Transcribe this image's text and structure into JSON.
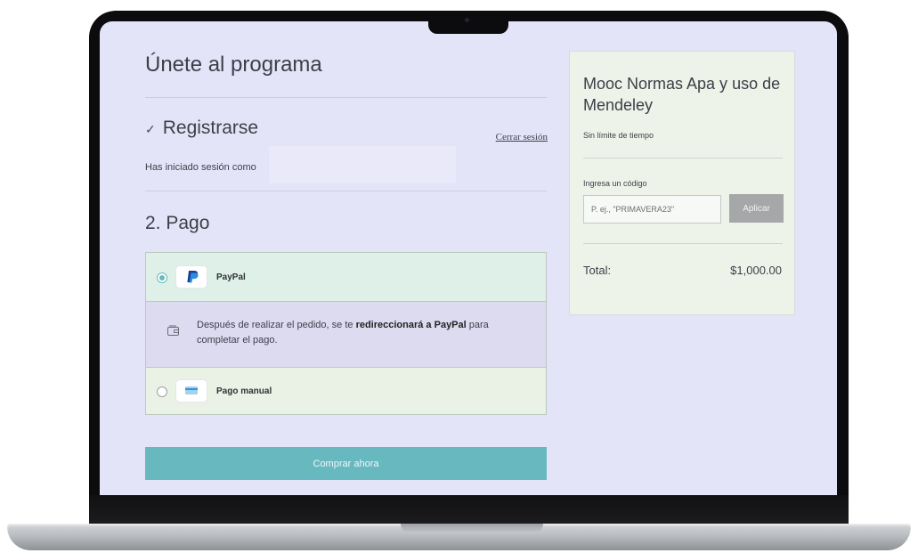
{
  "page": {
    "title": "Únete al programa",
    "step1": {
      "check": "✓",
      "title": "Registrarse",
      "logout": "Cerrar sesión",
      "session_text": "Has iniciado sesión como"
    },
    "step2": {
      "title": "2. Pago"
    },
    "payment": {
      "selected": "PayPal",
      "options": [
        {
          "label": "PayPal",
          "icon": "paypal-logo-icon",
          "selected": true
        },
        {
          "label": "Pago manual",
          "icon": "card-icon",
          "selected": false
        }
      ],
      "info": {
        "part1": "Después de realizar el pedido, se te ",
        "bold": "redireccionará a PayPal",
        "part2": " para completar el pago."
      }
    },
    "buy_button": "Comprar ahora"
  },
  "summary": {
    "course": "Mooc Normas Apa y uso de Mendeley",
    "duration": "Sin límite de tiempo",
    "code_label": "Ingresa un código",
    "code_placeholder": "P. ej., \"PRIMAVERA23\"",
    "apply": "Aplicar",
    "total_label": "Total:",
    "total_value": "$1,000.00"
  },
  "colors": {
    "screen_bg": "#e4e4f8",
    "accent": "#67b9bf",
    "card_bg": "#edf3e8",
    "paypal_row": "#dff0e8",
    "info_row": "#dcdbf0"
  }
}
